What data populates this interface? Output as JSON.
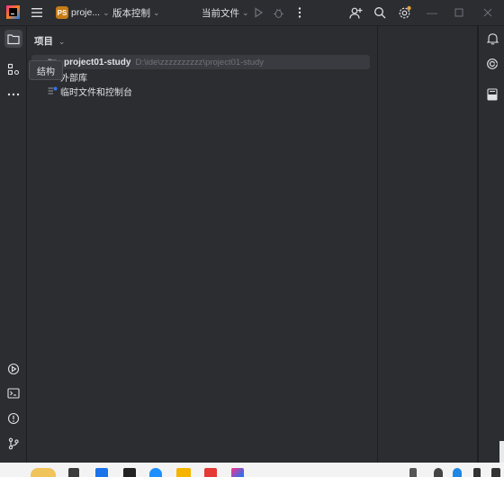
{
  "titlebar": {
    "project_badge": "PS",
    "project_name": "proje...",
    "vcs_label": "版本控制",
    "run_config": "当前文件"
  },
  "panel": {
    "title": "项目",
    "tree": [
      {
        "label": "project01-study",
        "path": "D:\\ide\\zzzzzzzzzz\\project01-study"
      },
      {
        "label": "外部库"
      },
      {
        "label": "临时文件和控制台"
      }
    ]
  },
  "tooltip": "结构",
  "colors": {
    "background": "#1e1f22",
    "panel": "#2b2d30",
    "selection": "#393b40",
    "accent": "#3574f0",
    "badge": "#c77d15"
  },
  "icons": {
    "left_top": [
      "folder-icon",
      "structure-icon",
      "more-icon"
    ],
    "left_bottom": [
      "services-icon",
      "terminal-icon",
      "problems-icon",
      "git-icon"
    ],
    "right": [
      "notifications-icon",
      "ai-assistant-icon",
      "database-icon"
    ]
  }
}
